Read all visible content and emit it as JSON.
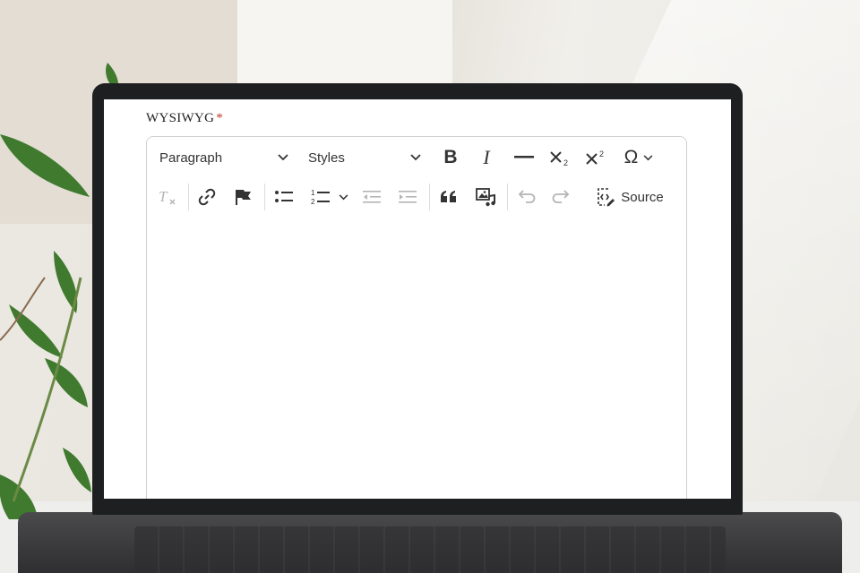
{
  "field": {
    "label": "WYSIWYG",
    "required_marker": "*"
  },
  "toolbar": {
    "row1": {
      "heading_select": "Paragraph",
      "styles_select": "Styles",
      "bold_label": "B",
      "italic_label": "I"
    },
    "row2": {
      "source_label": "Source"
    }
  },
  "editor": {
    "content": ""
  },
  "colors": {
    "required": "#c0392b",
    "toolbar_icon": "#333333",
    "disabled_icon": "#b5b5b5",
    "border": "#cfcfcf"
  }
}
